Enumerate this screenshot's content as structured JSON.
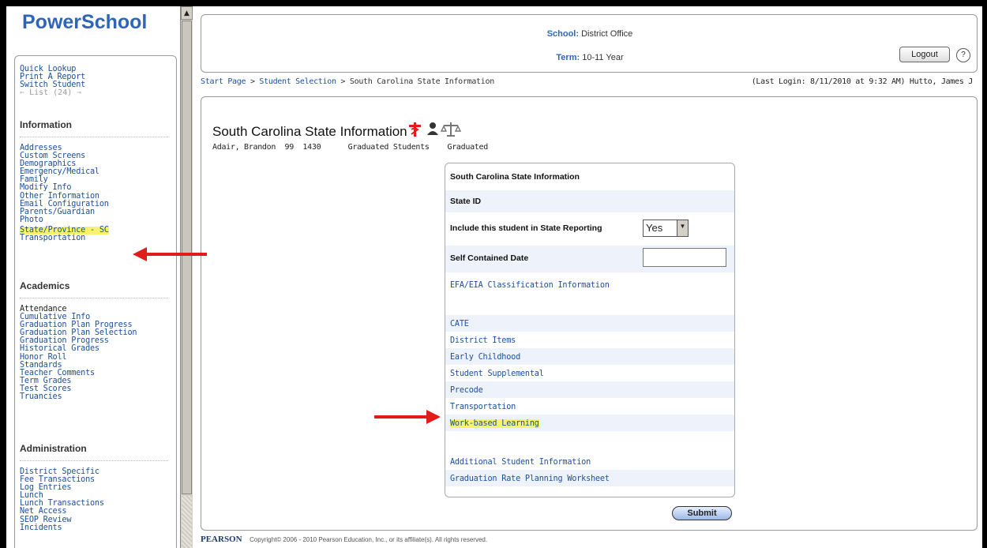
{
  "app": {
    "logo_main": "PowerSchool"
  },
  "nav": {
    "top_links": [
      "Quick Lookup",
      "Print A Report",
      "Switch Student"
    ],
    "list_label": "List (24)",
    "sections": [
      {
        "heading": "Information",
        "items": [
          "Addresses",
          "Custom Screens",
          "Demographics",
          "Emergency/Medical",
          "Family",
          "Modify Info",
          "Other Information",
          "Email Configuration",
          "Parents/Guardian",
          "Photo",
          "State/Province - SC",
          "Transportation"
        ]
      },
      {
        "heading": "Academics",
        "items": [
          "Attendance",
          "Cumulative Info",
          "Graduation Plan Progress",
          "Graduation Plan Selection",
          "Graduation Progress",
          "Historical Grades",
          "Honor Roll",
          "Standards",
          "Teacher Comments",
          "Term Grades",
          "Test Scores",
          "Truancies"
        ]
      },
      {
        "heading": "Administration",
        "items": [
          "District Specific",
          "Fee Transactions",
          "Log Entries",
          "Lunch",
          "Lunch Transactions",
          "Net Access",
          "SEOP Review",
          "Incidents"
        ]
      }
    ]
  },
  "header": {
    "school_label": "School:",
    "school_value": "District Office",
    "term_label": "Term:",
    "term_value": "10-11 Year",
    "logout_label": "Logout",
    "help_label": "?"
  },
  "breadcrumb": {
    "items": [
      "Start Page",
      "Student Selection"
    ],
    "separator": ">",
    "current": "South Carolina State Information",
    "last_login": "(Last Login: 8/11/2010 at 9:32 AM) Hutto, James J"
  },
  "page": {
    "title": "South Carolina State Information",
    "student_line": "Adair, Brandon  99  1430      Graduated Students    Graduated",
    "icons": [
      "medical-alert-icon",
      "person-icon",
      "scales-icon"
    ]
  },
  "panel": {
    "header": "South Carolina State Information",
    "state_id_label": "State ID",
    "include_label": "Include this student in State Reporting",
    "include_value": "Yes",
    "self_contained_label": "Self Contained Date",
    "self_contained_value": "",
    "links_a": [
      "EFA/EIA Classification Information"
    ],
    "links_b": [
      "CATE",
      "District Items",
      "Early Childhood",
      "Student Supplemental",
      "Precode",
      "Transportation",
      "Work-based Learning"
    ],
    "links_c": [
      "Additional Student Information",
      "Graduation Rate Planning Worksheet"
    ]
  },
  "submit_label": "Submit",
  "footer": {
    "brand": "PEARSON",
    "copyright": "Copyright© 2006 - 2010 Pearson Education, Inc., or its affiliate(s). All rights reserved."
  },
  "colors": {
    "link": "#1b4f9e",
    "highlight": "#f7f36b",
    "arrow": "#e21b1b",
    "logo": "#2f65b8"
  }
}
